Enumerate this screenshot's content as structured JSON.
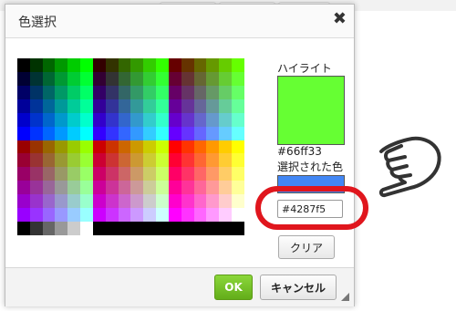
{
  "dialog": {
    "title": "色選択",
    "close_glyph": "✖"
  },
  "palette": {
    "rows": [
      [
        "#000000",
        "#003300",
        "#006600",
        "#009900",
        "#00cc00",
        "#00ff00",
        "#330000",
        "#333300",
        "#336600",
        "#339900",
        "#33cc00",
        "#33ff00",
        "#660000",
        "#663300",
        "#666600",
        "#669900",
        "#66cc00",
        "#66ff00"
      ],
      [
        "#000033",
        "#003333",
        "#006633",
        "#009933",
        "#00cc33",
        "#00ff33",
        "#330033",
        "#333333",
        "#336633",
        "#339933",
        "#33cc33",
        "#33ff33",
        "#660033",
        "#663333",
        "#666633",
        "#669933",
        "#66cc33",
        "#66ff33"
      ],
      [
        "#000066",
        "#003366",
        "#006666",
        "#009966",
        "#00cc66",
        "#00ff66",
        "#330066",
        "#333366",
        "#336666",
        "#339966",
        "#33cc66",
        "#33ff66",
        "#660066",
        "#663366",
        "#666666",
        "#669966",
        "#66cc66",
        "#66ff66"
      ],
      [
        "#000099",
        "#003399",
        "#006699",
        "#009999",
        "#00cc99",
        "#00ff99",
        "#330099",
        "#333399",
        "#336699",
        "#339999",
        "#33cc99",
        "#33ff99",
        "#660099",
        "#663399",
        "#666699",
        "#669999",
        "#66cc99",
        "#66ff99"
      ],
      [
        "#0000cc",
        "#0033cc",
        "#0066cc",
        "#0099cc",
        "#00cccc",
        "#00ffcc",
        "#3300cc",
        "#3333cc",
        "#3366cc",
        "#3399cc",
        "#33cccc",
        "#33ffcc",
        "#6600cc",
        "#6633cc",
        "#6666cc",
        "#6699cc",
        "#66cccc",
        "#66ffcc"
      ],
      [
        "#0000ff",
        "#0033ff",
        "#0066ff",
        "#0099ff",
        "#00ccff",
        "#00ffff",
        "#3300ff",
        "#3333ff",
        "#3366ff",
        "#3399ff",
        "#33ccff",
        "#33ffff",
        "#6600ff",
        "#6633ff",
        "#6666ff",
        "#6699ff",
        "#66ccff",
        "#66ffff"
      ],
      [
        "#990000",
        "#993300",
        "#996600",
        "#999900",
        "#99cc00",
        "#99ff00",
        "#cc0000",
        "#cc3300",
        "#cc6600",
        "#cc9900",
        "#cccc00",
        "#ccff00",
        "#ff0000",
        "#ff3300",
        "#ff6600",
        "#ff9900",
        "#ffcc00",
        "#ffff00"
      ],
      [
        "#990033",
        "#993333",
        "#996633",
        "#999933",
        "#99cc33",
        "#99ff33",
        "#cc0033",
        "#cc3333",
        "#cc6633",
        "#cc9933",
        "#cccc33",
        "#ccff33",
        "#ff0033",
        "#ff3333",
        "#ff6633",
        "#ff9933",
        "#ffcc33",
        "#ffff33"
      ],
      [
        "#990066",
        "#993366",
        "#996666",
        "#999966",
        "#99cc66",
        "#99ff66",
        "#cc0066",
        "#cc3366",
        "#cc6666",
        "#cc9966",
        "#cccc66",
        "#ccff66",
        "#ff0066",
        "#ff3366",
        "#ff6666",
        "#ff9966",
        "#ffcc66",
        "#ffff66"
      ],
      [
        "#990099",
        "#993399",
        "#996699",
        "#999999",
        "#99cc99",
        "#99ff99",
        "#cc0099",
        "#cc3399",
        "#cc6699",
        "#cc9999",
        "#cccc99",
        "#ccff99",
        "#ff0099",
        "#ff3399",
        "#ff6699",
        "#ff9999",
        "#ffcc99",
        "#ffff99"
      ],
      [
        "#9900cc",
        "#9933cc",
        "#9966cc",
        "#9999cc",
        "#99cccc",
        "#99ffcc",
        "#cc00cc",
        "#cc33cc",
        "#cc66cc",
        "#cc99cc",
        "#cccccc",
        "#ccffcc",
        "#ff00cc",
        "#ff33cc",
        "#ff66cc",
        "#ff99cc",
        "#ffcccc",
        "#ffffcc"
      ],
      [
        "#9900ff",
        "#9933ff",
        "#9966ff",
        "#9999ff",
        "#99ccff",
        "#99ffff",
        "#cc00ff",
        "#cc33ff",
        "#cc66ff",
        "#cc99ff",
        "#ccccff",
        "#ccffff",
        "#ff00ff",
        "#ff33ff",
        "#ff66ff",
        "#ff99ff",
        "#ffccff",
        "#ffffff"
      ],
      [
        "#000000",
        "#333333",
        "#666666",
        "#999999",
        "#cccccc",
        "#ffffff",
        "#000000",
        "#000000",
        "#000000",
        "#000000",
        "#000000",
        "#000000",
        "#000000",
        "#000000",
        "#000000",
        "#000000",
        "#000000",
        "#000000"
      ]
    ]
  },
  "highlight": {
    "label": "ハイライト",
    "color": "#66ff33",
    "hex_label": "#66ff33"
  },
  "selected": {
    "label": "選択された色",
    "color": "#4287f5",
    "value": "#4287f5"
  },
  "buttons": {
    "clear": "クリア",
    "ok": "OK",
    "cancel": "キャンセル"
  },
  "annotation": {
    "ring_color": "#e0161d",
    "hand_icon": "pointing-hand-icon"
  }
}
